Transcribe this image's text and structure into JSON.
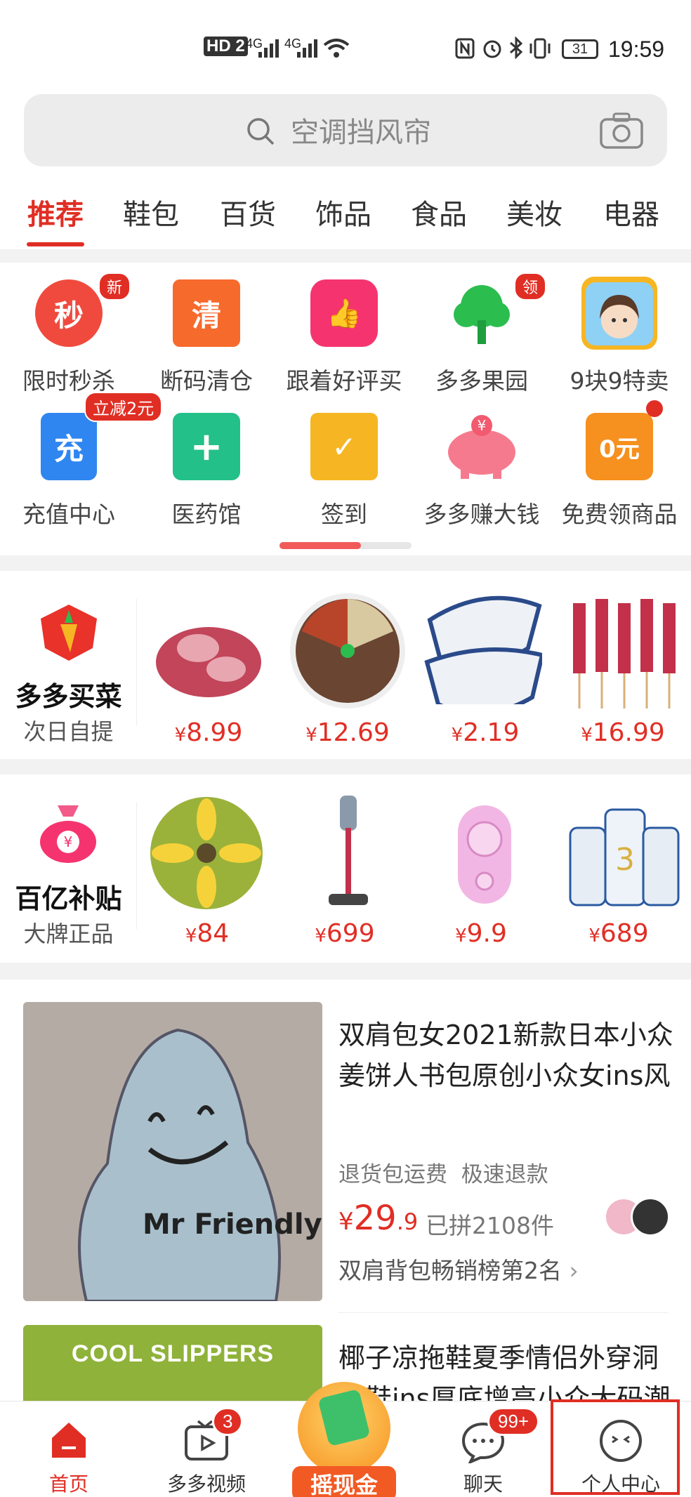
{
  "status_bar": {
    "network_left": "HD 2",
    "signal1": "4G",
    "signal2": "4G",
    "battery": "31",
    "time": "19:59"
  },
  "search": {
    "placeholder": "空调挡风帘",
    "icons": [
      "search-icon",
      "camera-icon"
    ]
  },
  "tabs": [
    {
      "label": "推荐",
      "active": true
    },
    {
      "label": "鞋包"
    },
    {
      "label": "百货"
    },
    {
      "label": "饰品"
    },
    {
      "label": "食品"
    },
    {
      "label": "美妆"
    },
    {
      "label": "电器"
    }
  ],
  "grid": {
    "row1": [
      {
        "label": "限时秒杀",
        "icon_text": "秒",
        "badge": "新",
        "color": "#f04a3e"
      },
      {
        "label": "断码清仓",
        "icon_text": "清",
        "color": "#f66a2c"
      },
      {
        "label": "跟着好评买",
        "icon_text": "👍",
        "color": "#f5346f"
      },
      {
        "label": "多多果园",
        "icon_text": "",
        "badge": "领",
        "color": "#2cbd4f"
      },
      {
        "label": "9块9特卖",
        "icon_text": "",
        "color": "#6bb6f0"
      }
    ],
    "row2": [
      {
        "label": "充值中心",
        "icon_text": "充",
        "badge": "立减2元",
        "color": "#2f86f0"
      },
      {
        "label": "医药馆",
        "icon_text": "+",
        "color": "#23c08a"
      },
      {
        "label": "签到",
        "icon_text": "✓",
        "color": "#f6b623"
      },
      {
        "label": "多多赚大钱",
        "icon_text": "¥",
        "color": "#f67a8d"
      },
      {
        "label": "免费领商品",
        "icon_text": "0元",
        "color": "#f6901e",
        "red_dot": true
      }
    ]
  },
  "promo1": {
    "title": "多多买菜",
    "subtitle": "次日自提",
    "prices": [
      "8.99",
      "12.69",
      "2.19",
      "16.99"
    ]
  },
  "promo2": {
    "title": "百亿补贴",
    "subtitle": "大牌正品",
    "prices": [
      "84",
      "699",
      "9.9",
      "689"
    ]
  },
  "currency": "¥",
  "feed": {
    "item1": {
      "title": "双肩包女2021新款日本小众姜饼人书包原创小众女ins风",
      "tag1": "退货包运费",
      "tag2": "极速退款",
      "price_int": "29",
      "price_dec": ".9",
      "sold": "已拼2108件",
      "rank": "双肩背包畅销榜第2名",
      "image_text": "Mr Friendly"
    },
    "item2": {
      "title": "椰子凉拖鞋夏季情侣外穿洞洞鞋ins厚底增高小众大码潮",
      "banner": "COOL SLIPPERS"
    }
  },
  "bottom_nav": [
    {
      "label": "首页",
      "active": true
    },
    {
      "label": "多多视频",
      "badge": "3"
    },
    {
      "label": "摇现金"
    },
    {
      "label": "聊天",
      "badge": "99+"
    },
    {
      "label": "个人中心",
      "highlighted": true
    }
  ],
  "colors": {
    "accent": "#e02e24",
    "background": "#f2f2f2"
  }
}
